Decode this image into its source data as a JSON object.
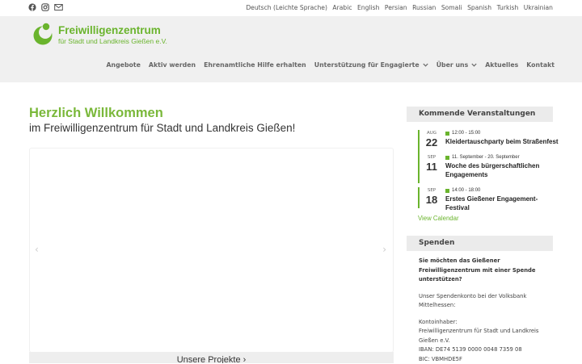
{
  "topbar": {
    "social": [
      "facebook-icon",
      "instagram-icon",
      "mail-icon"
    ],
    "languages": [
      "Deutsch (Leichte Sprache)",
      "Arabic",
      "English",
      "Persian",
      "Russian",
      "Somali",
      "Spanish",
      "Turkish",
      "Ukrainian"
    ]
  },
  "logo": {
    "title": "Freiwilligenzentrum",
    "subtitle": "für Stadt und Landkreis Gießen e.V."
  },
  "nav": [
    {
      "label": "Angebote",
      "dropdown": false
    },
    {
      "label": "Aktiv werden",
      "dropdown": false
    },
    {
      "label": "Ehrenamtliche Hilfe erhalten",
      "dropdown": false
    },
    {
      "label": "Unterstützung für Engagierte",
      "dropdown": true
    },
    {
      "label": "Über uns",
      "dropdown": true
    },
    {
      "label": "Aktuelles",
      "dropdown": false
    },
    {
      "label": "Kontakt",
      "dropdown": false
    }
  ],
  "main": {
    "welcome": "Herzlich Willkommen",
    "subtitle": "im Freiwilligenzentrum für Stadt und Landkreis Gießen!",
    "slider_prev": "‹",
    "slider_next": "›",
    "slider_caption": "Unsere Projekte ›"
  },
  "events": {
    "title": "Kommende Veranstaltungen",
    "items": [
      {
        "month": "AUG",
        "day": "22",
        "time": "12:00 - 15:00",
        "title": "Kleidertauschparty beim Straßenfest"
      },
      {
        "month": "SEP",
        "day": "11",
        "time": "11. September - 20. September",
        "title": "Woche des bürgerschaftlichen Engagements"
      },
      {
        "month": "SEP",
        "day": "18",
        "time": "14:00 - 18:00",
        "title": "Erstes Gießener Engagement-Festival"
      }
    ],
    "view_calendar": "View Calendar"
  },
  "donate": {
    "title": "Spenden",
    "question": "Sie möchten das Gießener Freiwilligenzentrum mit einer Spende unterstützen?",
    "account_intro": "Unser Spendenkonto bei der Volksbank Mittelhessen:",
    "holder_label": "Kontoinhaber:",
    "holder": "Freiwilligenzentrum für Stadt und Landkreis Gießen e.V.",
    "iban": "IBAN: DE74 5139 0000 0048 7359 08",
    "bic": "BIC: VBMHDE5F"
  },
  "colors": {
    "brand_green": "#6ab42d",
    "header_bg": "#f0f0f0"
  }
}
